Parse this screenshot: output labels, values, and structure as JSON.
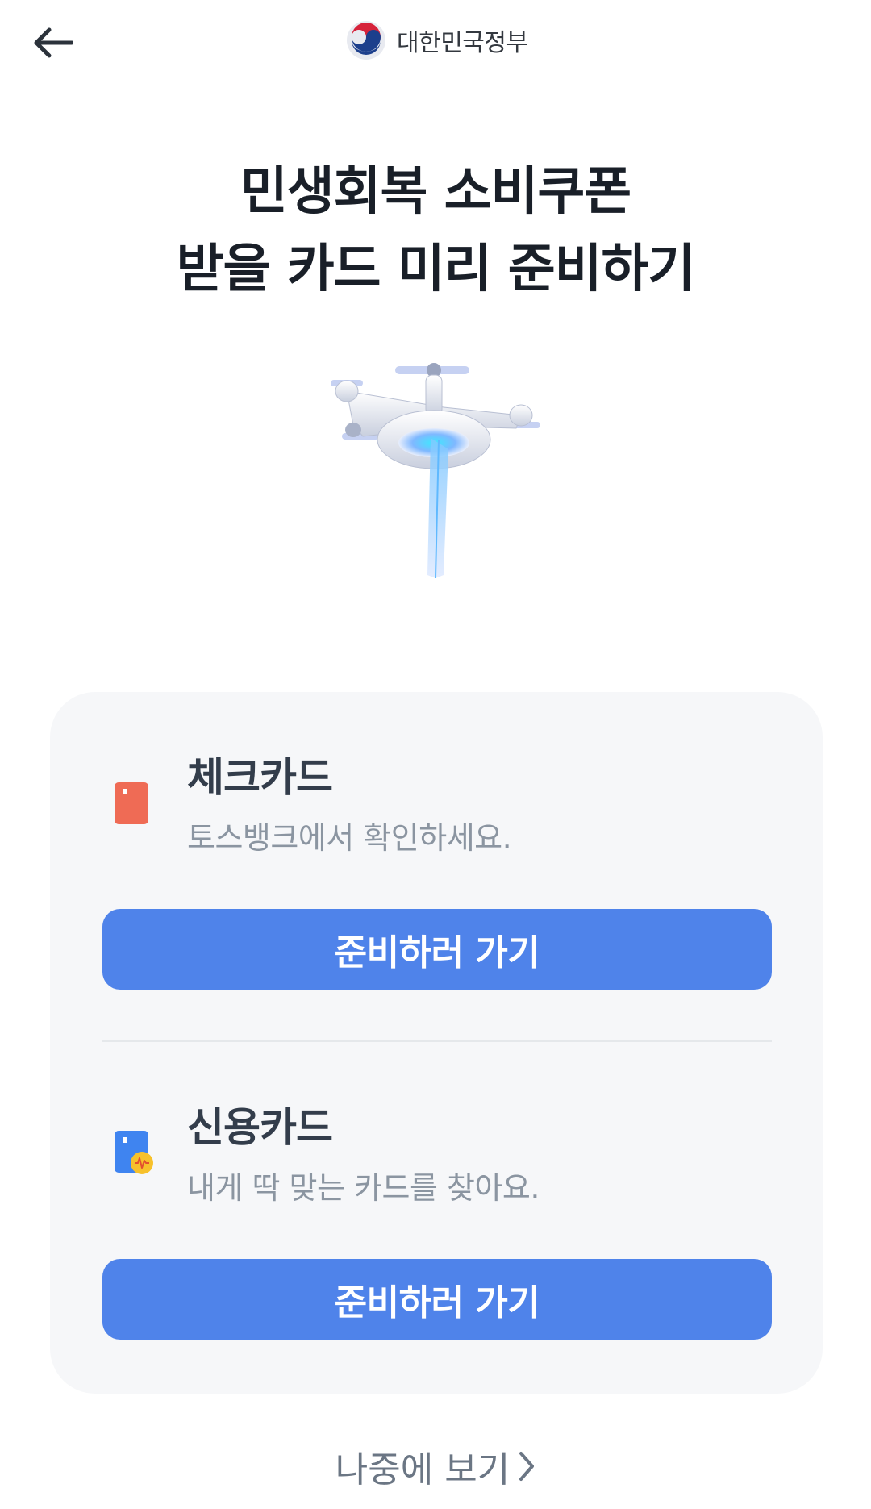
{
  "header": {
    "back_icon": "arrow-left-icon",
    "gov_logo_icon": "taegeuk-emblem-icon",
    "gov_name": "대한민국정부"
  },
  "headline": {
    "line1": "민생회복 소비쿠폰",
    "line2": "받을 카드 미리 준비하기"
  },
  "hero": {
    "icon": "drone-illustration"
  },
  "cards": [
    {
      "icon": "debit-card-icon",
      "title": "체크카드",
      "description": "토스뱅크에서 확인하세요.",
      "button_label": "준비하러 가기"
    },
    {
      "icon": "credit-card-icon",
      "title": "신용카드",
      "description": "내게 딱 맞는 카드를 찾아요.",
      "button_label": "준비하러 가기"
    }
  ],
  "footer": {
    "later_label": "나중에 보기",
    "later_icon": "chevron-right-icon"
  },
  "colors": {
    "primary_button": "#4f83ea",
    "panel_background": "#f6f7f9",
    "debit_card": "#ef6b55",
    "credit_card": "#3f84f0",
    "credit_badge": "#f7c12b"
  }
}
